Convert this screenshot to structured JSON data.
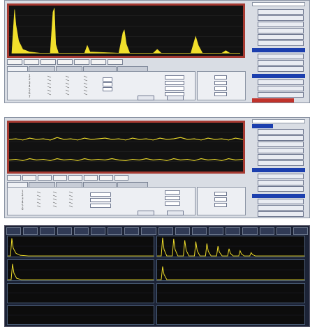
{
  "windows": [
    {
      "name": "spectrum-window",
      "axis_labels": [
        "",
        "",
        "",
        "",
        "",
        "",
        ""
      ],
      "tabs": [
        "",
        "",
        "",
        "",
        ""
      ],
      "grid_rows": [
        "1",
        "2",
        "3",
        "4",
        "5",
        "6",
        "7",
        "8"
      ],
      "param_fields": [
        "",
        "",
        "",
        "",
        ""
      ],
      "right_fields": [
        "",
        "",
        "",
        ""
      ],
      "right_units": [
        "",
        "",
        "",
        ""
      ],
      "buttons": [
        "",
        ""
      ],
      "sidebar_buttons": [
        "",
        "",
        "",
        "",
        "",
        "",
        "",
        "",
        "",
        "",
        "",
        "",
        "",
        ""
      ]
    },
    {
      "name": "waveform-window",
      "axis_labels": [
        "",
        "",
        "",
        "",
        "",
        "",
        "",
        ""
      ],
      "tabs": [
        "",
        "",
        "",
        "",
        ""
      ],
      "grid_rows": [
        "1",
        "2",
        "3",
        "4",
        "5",
        "6",
        "7",
        "8"
      ],
      "param_fields": [
        "",
        "",
        "",
        "",
        ""
      ],
      "right_fields": [
        "",
        "",
        ""
      ],
      "right_units": [
        "",
        "",
        ""
      ],
      "buttons": [
        "",
        ""
      ],
      "sidebar_buttons": [
        "",
        "",
        "",
        "",
        "",
        "",
        "",
        "",
        "",
        "",
        "",
        "",
        "",
        ""
      ]
    },
    {
      "name": "multichannel-window",
      "strip_items": [
        "",
        "",
        "",
        "",
        "",
        "",
        "",
        "",
        "",
        "",
        "",
        "",
        "",
        "",
        "",
        "",
        "",
        "",
        "",
        ""
      ]
    }
  ],
  "colors": {
    "plot_bg": "#121212",
    "plot_border": "#a63a32",
    "trace": "#f1df2b",
    "side_accent": "#1c3fae",
    "panel_bg": "#d9dde4"
  },
  "icons": [
    "window-frame-icon"
  ]
}
